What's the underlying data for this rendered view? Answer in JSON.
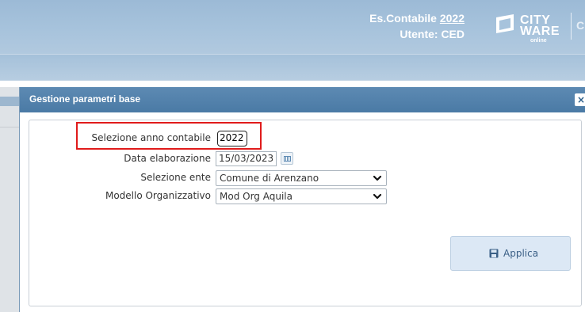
{
  "header": {
    "fiscal_year_label": "Es.Contabile",
    "fiscal_year_value": "2022",
    "user_label": "Utente: CED",
    "logo_line1": "CITY",
    "logo_line2": "WARE",
    "logo_line3": "online",
    "cut_text": "C"
  },
  "dialog": {
    "title": "Gestione parametri base",
    "close_glyph": "×"
  },
  "form": {
    "year_label": "Selezione anno contabile",
    "year_value": "2022",
    "date_label": "Data elaborazione",
    "date_value": "15/03/2023",
    "ente_label": "Selezione ente",
    "ente_value": "Comune di Arenzano",
    "modello_label": "Modello Organizzativo",
    "modello_value": "Mod Org Aquila"
  },
  "actions": {
    "apply_label": "Applica"
  },
  "colors": {
    "header_bg": "#a7c3dc",
    "titlebar_bg": "#4a7aa5",
    "highlight": "#e01b1b",
    "apply_bg": "#dce8f5"
  }
}
